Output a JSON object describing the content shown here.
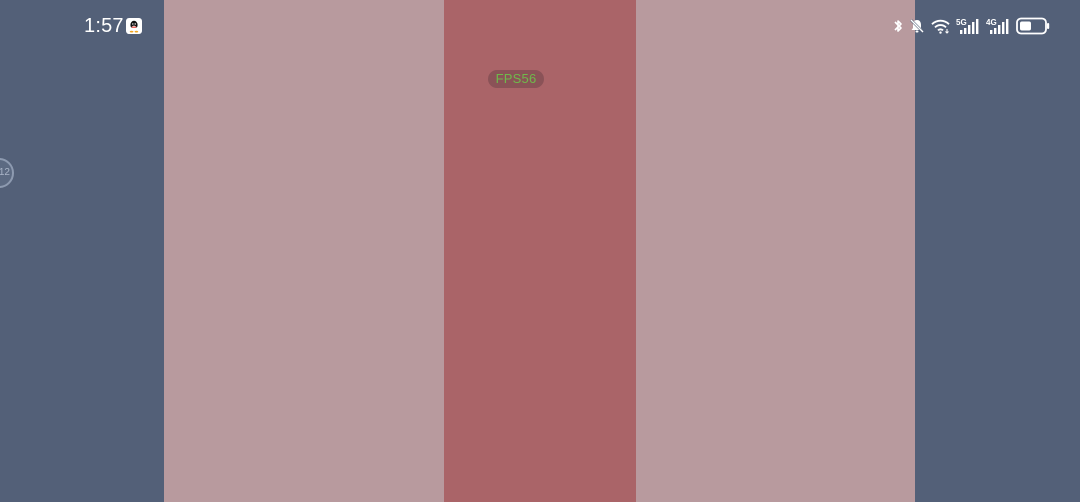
{
  "status_bar": {
    "time": "1:57",
    "signal_5g_label": "5G",
    "signal_4g_label": "4G",
    "icons": [
      "qq-icon",
      "bluetooth-icon",
      "bell-muted-icon",
      "wifi-icon",
      "signal-5g-icon",
      "signal-4g-icon",
      "battery-icon"
    ]
  },
  "overlay": {
    "fps_label": "FPS56"
  },
  "floating_handle": {
    "label": "12"
  },
  "colors": {
    "background": "#536078",
    "band_light": "#b89a9e",
    "band_center": "#aa6468",
    "fps_text": "#6fb94b"
  }
}
